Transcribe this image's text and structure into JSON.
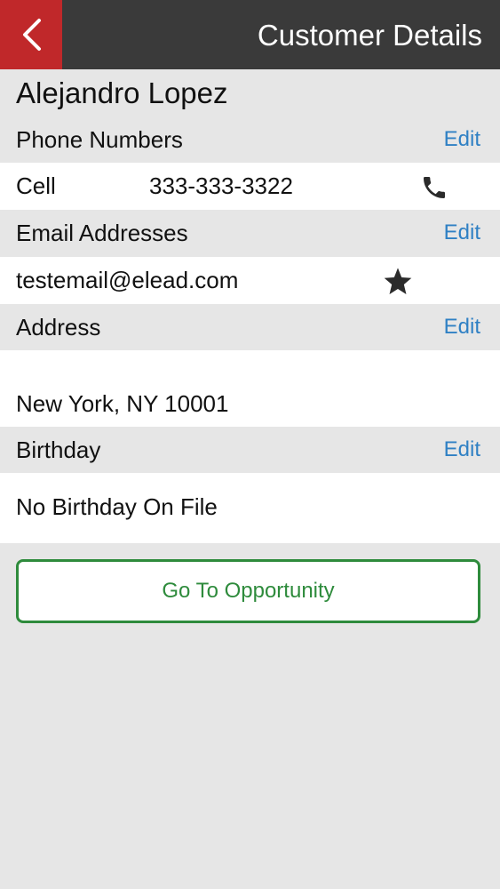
{
  "header": {
    "title": "Customer Details"
  },
  "customer": {
    "name": "Alejandro Lopez"
  },
  "phone": {
    "section_label": "Phone Numbers",
    "edit_label": "Edit",
    "type": "Cell",
    "number": "333-333-3322"
  },
  "email": {
    "section_label": "Email Addresses",
    "edit_label": "Edit",
    "address": "testemail@elead.com"
  },
  "address": {
    "section_label": "Address",
    "edit_label": "Edit",
    "city_line": "New York, NY 10001"
  },
  "birthday": {
    "section_label": "Birthday",
    "edit_label": "Edit",
    "value": "No Birthday On File"
  },
  "actions": {
    "go_to_opportunity": "Go To Opportunity"
  },
  "colors": {
    "header_bg": "#3a3a3a",
    "back_bg": "#c0282a",
    "edit_link": "#2f80c4",
    "button_green": "#2e8b3c"
  },
  "icons": {
    "back": "chevron-left-icon",
    "call": "phone-icon",
    "primary_email": "star-icon"
  }
}
